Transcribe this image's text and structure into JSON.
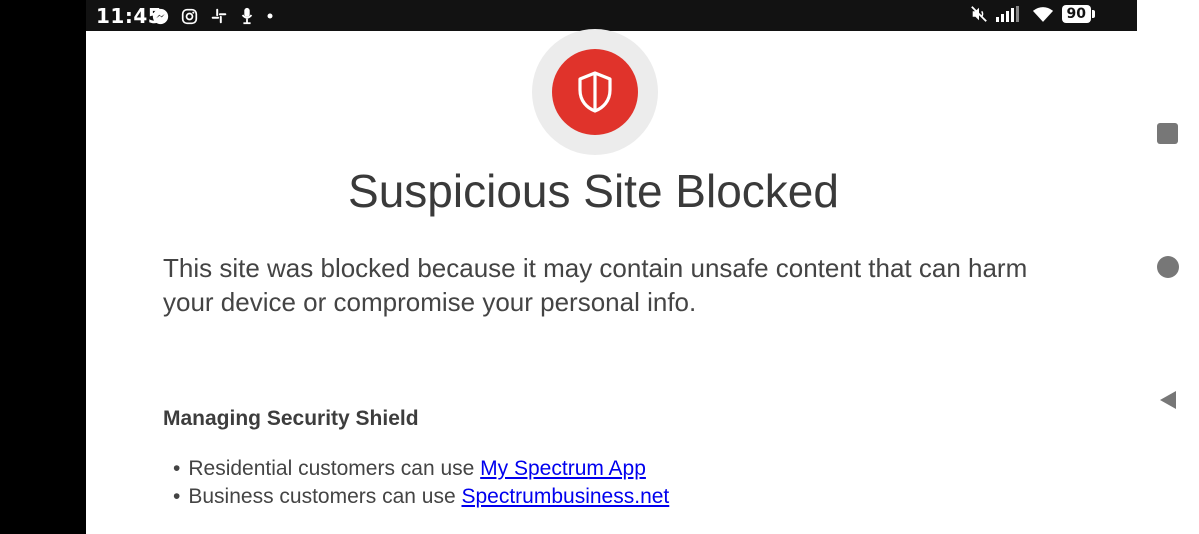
{
  "status_bar": {
    "time": "11:45",
    "notification_icons": [
      "messenger-icon",
      "instagram-icon",
      "slack-icon",
      "podcast-icon",
      "more-dot-icon"
    ],
    "system_icons": [
      "mute-icon",
      "signal-icon",
      "wifi-icon"
    ],
    "battery_level": "90"
  },
  "page": {
    "title": "Suspicious Site Blocked",
    "description": "This site was blocked because it may contain unsafe content that can harm your device or compromise your personal info.",
    "section_heading": "Managing Security Shield",
    "items": [
      {
        "text": "Residential customers can use ",
        "link": "My Spectrum App"
      },
      {
        "text": "Business customers can use ",
        "link": "Spectrumbusiness.net"
      }
    ]
  },
  "nav": {
    "buttons": [
      "recents-icon",
      "home-icon",
      "back-icon"
    ]
  },
  "colors": {
    "shield_red": "#e0332b",
    "link": "#0000ee",
    "status_bar": "#121212"
  }
}
